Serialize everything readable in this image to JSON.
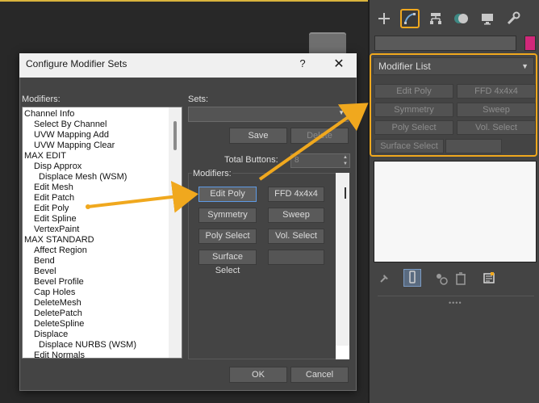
{
  "dialog": {
    "title": "Configure Modifier Sets",
    "help_glyph": "?",
    "close_glyph": "✕",
    "modifiers_label": "Modifiers:",
    "sets_label": "Sets:",
    "save_label": "Save",
    "delete_label": "Delete",
    "total_buttons_label": "Total Buttons:",
    "total_buttons_value": "8",
    "group_label": "Modifiers:",
    "ok_label": "OK",
    "cancel_label": "Cancel",
    "modifier_list": [
      "Channel Info",
      "Select By Channel",
      "UVW Mapping Add",
      "UVW Mapping Clear",
      "MAX EDIT",
      "Disp Approx",
      "Displace Mesh (WSM)",
      "Edit Mesh",
      "Edit Patch",
      "Edit Poly",
      "Edit Spline",
      "VertexPaint",
      "MAX STANDARD",
      "Affect Region",
      "Bend",
      "Bevel",
      "Bevel Profile",
      "Cap Holes",
      "DeleteMesh",
      "DeletePatch",
      "DeleteSpline",
      "Displace",
      "Displace NURBS (WSM)",
      "Edit Normals"
    ],
    "buttons": [
      "Edit Poly",
      "FFD 4x4x4",
      "Symmetry",
      "Sweep",
      "Poly Select",
      "Vol. Select",
      "Surface Select",
      ""
    ]
  },
  "panel": {
    "tabs": [
      "create-icon",
      "modify-icon",
      "hierarchy-icon",
      "motion-icon",
      "display-icon",
      "utilities-icon"
    ],
    "modifier_list_label": "Modifier List",
    "buttons": [
      "Edit Poly",
      "FFD 4x4x4",
      "Symmetry",
      "Sweep",
      "Poly Select",
      "Vol. Select",
      "Surface Select",
      ""
    ],
    "highlight_color": "#f0a81e",
    "object_color": "#d1287a"
  }
}
